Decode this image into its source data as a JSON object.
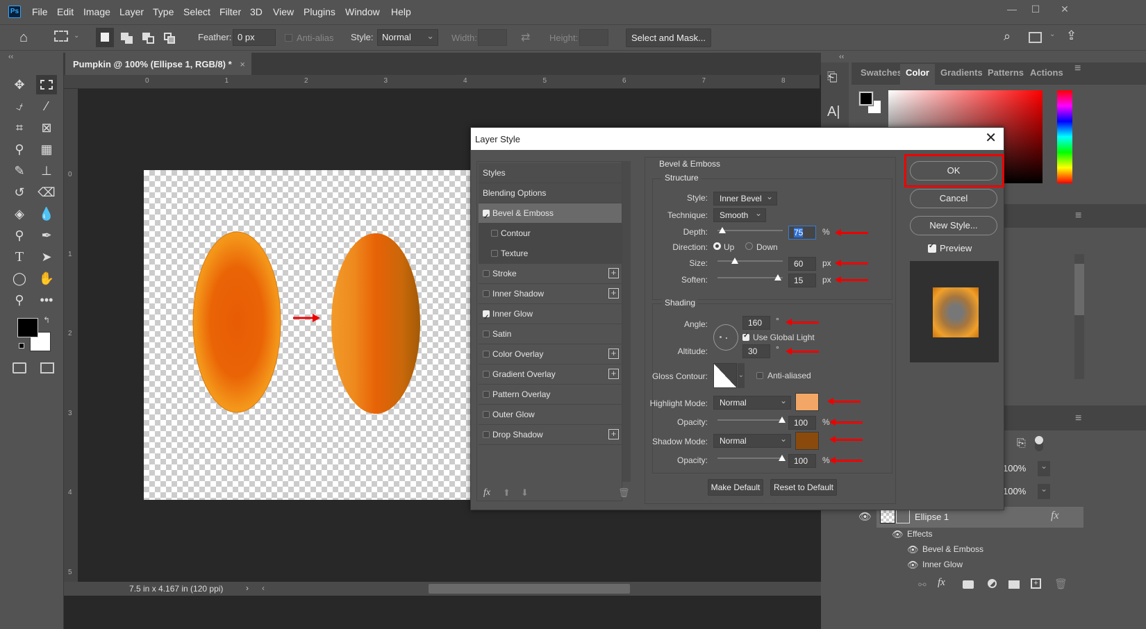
{
  "app": {
    "logo": "Ps",
    "title_menu": [
      "File",
      "Edit",
      "Image",
      "Layer",
      "Type",
      "Select",
      "Filter",
      "3D",
      "View",
      "Plugins",
      "Window",
      "Help"
    ]
  },
  "window_controls": {
    "minimize": "—",
    "maximize": "☐",
    "close": "✕"
  },
  "options_bar": {
    "feather_label": "Feather:",
    "feather_value": "0 px",
    "anti_alias_label": "Anti-alias",
    "style_label": "Style:",
    "style_value": "Normal",
    "width_label": "Width:",
    "height_label": "Height:",
    "select_mask_label": "Select and Mask..."
  },
  "document": {
    "tab_title": "Pumpkin @ 100% (Ellipse 1, RGB/8) *",
    "ruler_top": [
      "0",
      "1",
      "2",
      "3",
      "4",
      "5",
      "6",
      "7",
      "8"
    ],
    "ruler_left": [
      "0",
      "1",
      "2",
      "3",
      "4",
      "5"
    ],
    "status": "7.5 in x 4.167 in (120 ppi)"
  },
  "panels": {
    "tabs": [
      "Swatches",
      "Color",
      "Gradients",
      "Patterns",
      "Actions"
    ],
    "active_tab": "Color",
    "fill_pct": "100%",
    "opacity_pct": "100%",
    "layer": {
      "name": "Ellipse 1",
      "fx": "fx",
      "effects_label": "Effects",
      "effects": [
        "Bevel & Emboss",
        "Inner Glow"
      ]
    }
  },
  "dialog": {
    "title": "Layer Style",
    "styles": [
      {
        "label": "Styles",
        "type": "header"
      },
      {
        "label": "Blending Options",
        "type": "header"
      },
      {
        "label": "Bevel & Emboss",
        "checked": true,
        "selected": true
      },
      {
        "label": "Contour",
        "checked": false,
        "sub": true
      },
      {
        "label": "Texture",
        "checked": false,
        "sub": true
      },
      {
        "label": "Stroke",
        "checked": false,
        "plus": true
      },
      {
        "label": "Inner Shadow",
        "checked": false,
        "plus": true
      },
      {
        "label": "Inner Glow",
        "checked": true
      },
      {
        "label": "Satin",
        "checked": false
      },
      {
        "label": "Color Overlay",
        "checked": false,
        "plus": true
      },
      {
        "label": "Gradient Overlay",
        "checked": false,
        "plus": true
      },
      {
        "label": "Pattern Overlay",
        "checked": false
      },
      {
        "label": "Outer Glow",
        "checked": false
      },
      {
        "label": "Drop Shadow",
        "checked": false,
        "plus": true
      }
    ],
    "section_title": "Bevel & Emboss",
    "structure": {
      "title": "Structure",
      "style_label": "Style:",
      "style_value": "Inner Bevel",
      "technique_label": "Technique:",
      "technique_value": "Smooth",
      "depth_label": "Depth:",
      "depth_value": "75",
      "depth_unit": "%",
      "depth_slider": 0.07,
      "direction_label": "Direction:",
      "direction_up": "Up",
      "direction_down": "Down",
      "direction_selected": "Up",
      "size_label": "Size:",
      "size_value": "60",
      "size_unit": "px",
      "size_slider": 0.27,
      "soften_label": "Soften:",
      "soften_value": "15",
      "soften_unit": "px",
      "soften_slider": 0.93
    },
    "shading": {
      "title": "Shading",
      "angle_label": "Angle:",
      "angle_value": "160",
      "angle_unit": "°",
      "global_light_label": "Use Global Light",
      "global_light": true,
      "altitude_label": "Altitude:",
      "altitude_value": "30",
      "altitude_unit": "°",
      "gloss_label": "Gloss Contour:",
      "anti_aliased_label": "Anti-aliased",
      "highlight_label": "Highlight Mode:",
      "highlight_mode": "Normal",
      "highlight_color": "#f2a766",
      "h_opacity_label": "Opacity:",
      "h_opacity_value": "100",
      "h_opacity_unit": "%",
      "shadow_label": "Shadow Mode:",
      "shadow_mode": "Normal",
      "shadow_color": "#8a4a0c",
      "s_opacity_label": "Opacity:",
      "s_opacity_value": "100",
      "s_opacity_unit": "%"
    },
    "make_default": "Make Default",
    "reset_default": "Reset to Default",
    "ok": "OK",
    "cancel": "Cancel",
    "new_style": "New Style...",
    "preview_label": "Preview"
  },
  "colors": {
    "accent_red": "#e00000",
    "orange": "#f08a1c"
  }
}
